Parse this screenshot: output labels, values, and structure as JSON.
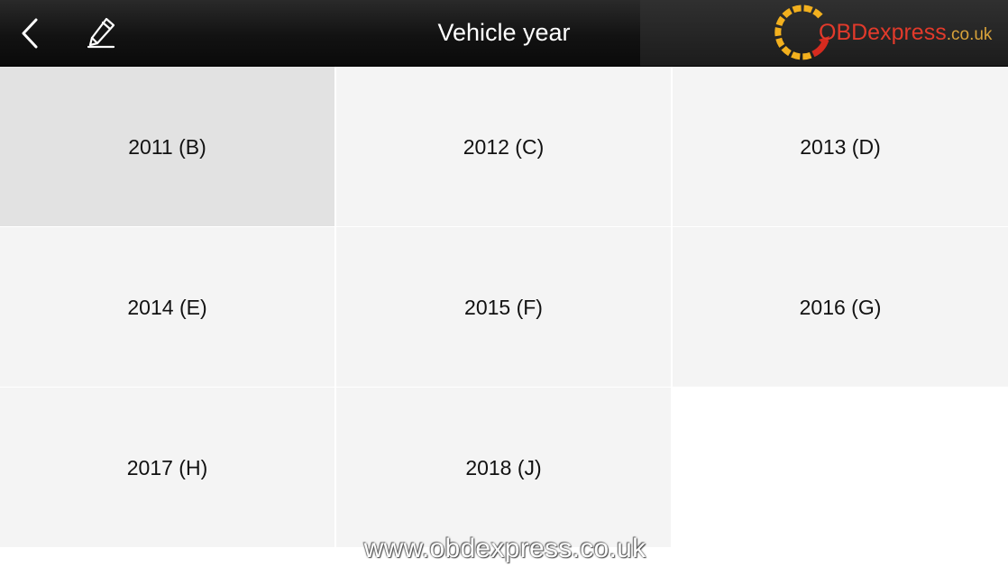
{
  "header": {
    "title": "Vehicle year",
    "back_icon": "chevron-left-icon",
    "edit_icon": "pencil-icon"
  },
  "logo": {
    "brand": "OBDexpress",
    "tld": ".co.uk",
    "colors": {
      "brand": "#e23a2b",
      "ring": "#f2b01e",
      "tld": "#d8a23a"
    }
  },
  "years": [
    {
      "label": "2011 (B)",
      "selected": true
    },
    {
      "label": "2012 (C)",
      "selected": false
    },
    {
      "label": "2013 (D)",
      "selected": false
    },
    {
      "label": "2014 (E)",
      "selected": false
    },
    {
      "label": "2015 (F)",
      "selected": false
    },
    {
      "label": "2016 (G)",
      "selected": false
    },
    {
      "label": "2017 (H)",
      "selected": false
    },
    {
      "label": "2018 (J)",
      "selected": false
    }
  ],
  "watermark": "www.obdexpress.co.uk",
  "colors": {
    "header_bg": "#121212",
    "cell_bg": "#f4f4f4",
    "cell_selected_bg": "#e2e2e2",
    "divider": "#ebebeb"
  }
}
